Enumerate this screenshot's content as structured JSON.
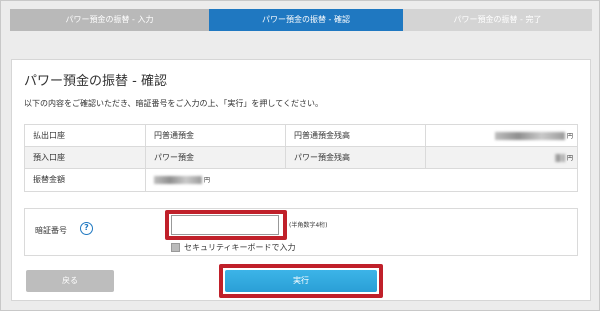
{
  "steps": [
    {
      "label": "パワー預金の振替 - 入力",
      "state": "done"
    },
    {
      "label": "パワー預金の振替 - 確認",
      "state": "current"
    },
    {
      "label": "パワー預金の振替 - 完了",
      "state": "upcoming"
    }
  ],
  "page": {
    "title": "パワー預金の振替 - 確認",
    "instruction": "以下の内容をご確認いただき、暗証番号をご入力の上、「実行」を押してください。"
  },
  "transfer": {
    "from_label": "払出口座",
    "from_account": "円普通預金",
    "from_balance_label": "円普通預金残高",
    "to_label": "預入口座",
    "to_account": "パワー預金",
    "to_balance_label": "パワー預金残高",
    "amount_label": "振替金額",
    "yen_unit": "円"
  },
  "pin": {
    "label": "暗証番号",
    "help": "?",
    "value": "",
    "hint": "(半角数字4桁)",
    "keyboard_label": "セキュリティキーボードで入力"
  },
  "buttons": {
    "back": "戻る",
    "execute": "実行"
  },
  "colors": {
    "current_step": "#1f78c1",
    "done_step": "#b9b9b9",
    "upcoming_step": "#d4d4d4",
    "highlight": "#c0202a",
    "execute_button": "#2a9fd6"
  }
}
